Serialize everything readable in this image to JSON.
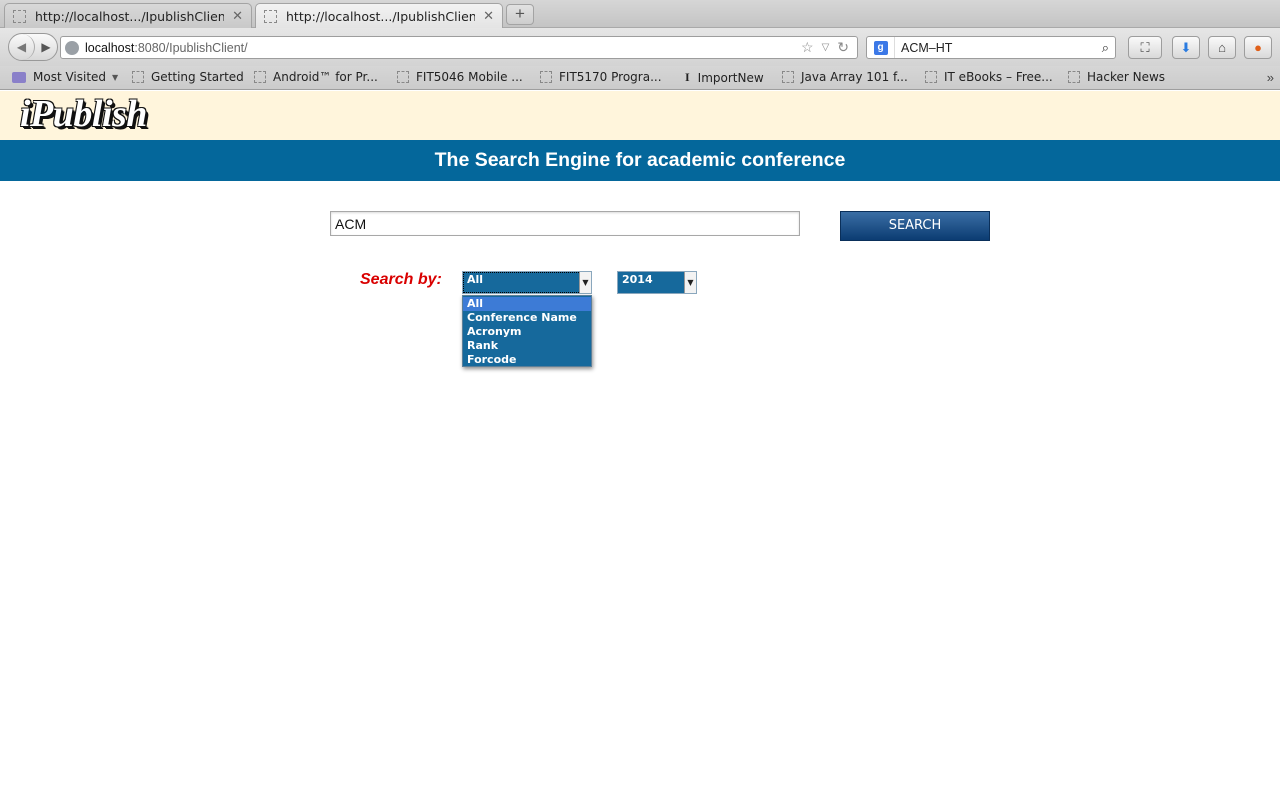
{
  "browser": {
    "tabs": [
      {
        "title": "http://localhost.../IpublishClient/",
        "close": "✕"
      },
      {
        "title": "http://localhost.../IpublishClient/",
        "close": "✕"
      }
    ],
    "new_tab": "+",
    "url_host": "localhost",
    "url_path": ":8080/IpublishClient/",
    "search_engine": "g",
    "search_text": "ACM–HT",
    "bookmarks": [
      {
        "label": "Most Visited",
        "icon": "folder-icon"
      },
      {
        "label": "Getting Started",
        "icon": "page-icon"
      },
      {
        "label": "Android™ for Pr...",
        "icon": "page-icon"
      },
      {
        "label": "FIT5046 Mobile ...",
        "icon": "page-icon"
      },
      {
        "label": "FIT5170 Progra...",
        "icon": "page-icon"
      },
      {
        "label": "ImportNew",
        "icon": "importnew-icon"
      },
      {
        "label": "Java Array 101 f...",
        "icon": "page-icon"
      },
      {
        "label": "IT eBooks – Free...",
        "icon": "page-icon"
      },
      {
        "label": "Hacker News",
        "icon": "page-icon"
      }
    ],
    "bookmarks_more": "»"
  },
  "page": {
    "logo": "iPublish",
    "title": "The Search Engine for academic conference",
    "search": {
      "value": "ACM",
      "button_label": "SEARCH"
    },
    "search_by_label": "Search by:",
    "filter_select": {
      "selected": "All",
      "options": [
        "All",
        "Conference Name",
        "Acronym",
        "Rank",
        "Forcode"
      ]
    },
    "year_select": {
      "selected": "2014"
    }
  },
  "colors": {
    "title_band": "#04679b",
    "logo_band": "#fff5dc",
    "search_by": "#d90000",
    "select_bg": "#16699c",
    "option_highlight": "#3d7bd6"
  }
}
